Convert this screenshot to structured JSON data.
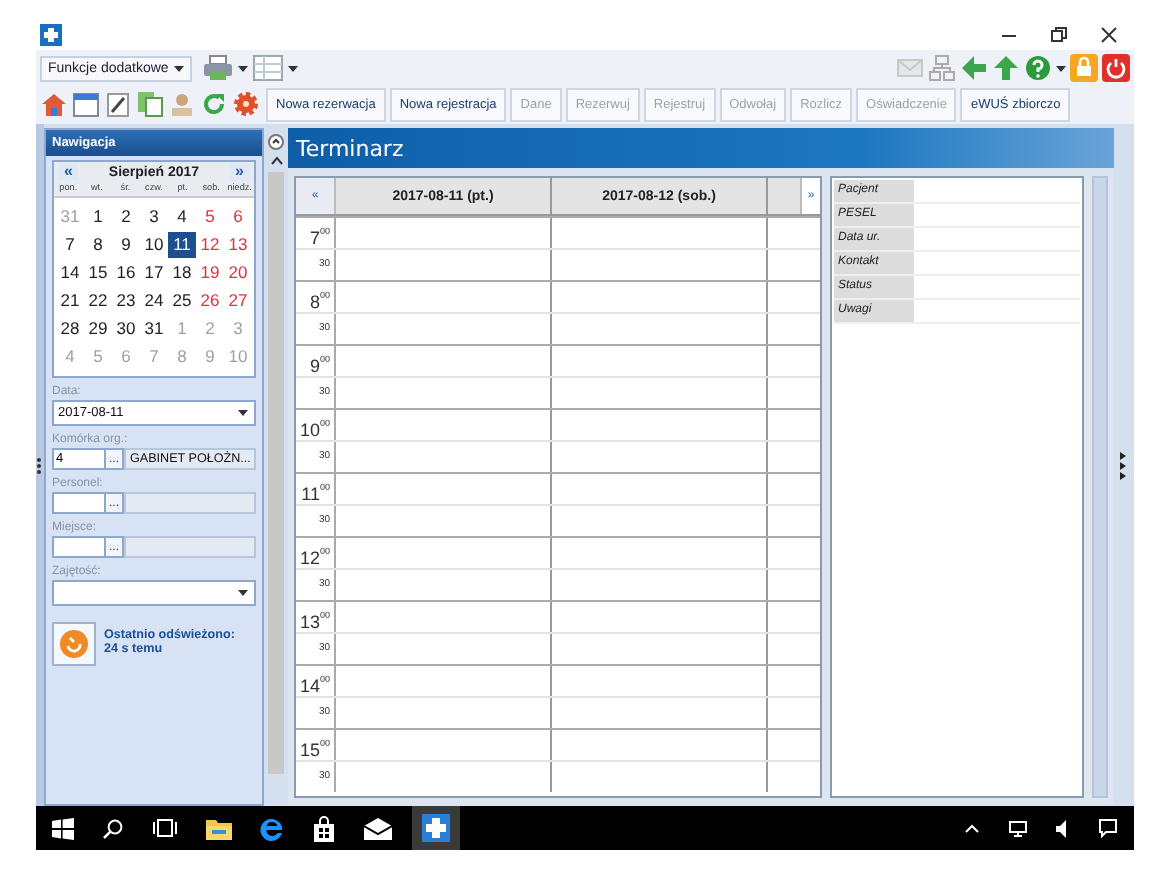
{
  "toolbar": {
    "menu": "Funkcje dodatkowe",
    "actions": [
      {
        "label": "Nowa rezerwacja",
        "disabled": false
      },
      {
        "label": "Nowa rejestracja",
        "disabled": false
      },
      {
        "label": "Dane",
        "disabled": true
      },
      {
        "label": "Rezerwuj",
        "disabled": true
      },
      {
        "label": "Rejestruj",
        "disabled": true
      },
      {
        "label": "Odwołaj",
        "disabled": true
      },
      {
        "label": "Rozlicz",
        "disabled": true
      },
      {
        "label": "Oświadczenie",
        "disabled": true
      },
      {
        "label": "eWUŚ zbiorczo",
        "disabled": false
      }
    ]
  },
  "navigation": {
    "title": "Nawigacja",
    "calendar": {
      "prev": "«",
      "month": "Sierpień 2017",
      "next": "»",
      "weekdays": [
        "pon.",
        "wt.",
        "śr.",
        "czw.",
        "pt.",
        "sob.",
        "niedz."
      ],
      "weeks": [
        [
          {
            "text": "31",
            "other_month": true,
            "selected": false
          },
          {
            "text": "1",
            "other_month": false,
            "selected": false
          },
          {
            "text": "2",
            "other_month": false,
            "selected": false
          },
          {
            "text": "3",
            "other_month": false,
            "selected": false
          },
          {
            "text": "4",
            "other_month": false,
            "selected": false
          },
          {
            "text": "5",
            "other_month": false,
            "selected": false
          },
          {
            "text": "6",
            "other_month": false,
            "selected": false
          }
        ],
        [
          {
            "text": "7",
            "other_month": false,
            "selected": false
          },
          {
            "text": "8",
            "other_month": false,
            "selected": false
          },
          {
            "text": "9",
            "other_month": false,
            "selected": false
          },
          {
            "text": "10",
            "other_month": false,
            "selected": false
          },
          {
            "text": "11",
            "other_month": false,
            "selected": true
          },
          {
            "text": "12",
            "other_month": false,
            "selected": false
          },
          {
            "text": "13",
            "other_month": false,
            "selected": false
          }
        ],
        [
          {
            "text": "14",
            "other_month": false,
            "selected": false
          },
          {
            "text": "15",
            "other_month": false,
            "selected": false
          },
          {
            "text": "16",
            "other_month": false,
            "selected": false
          },
          {
            "text": "17",
            "other_month": false,
            "selected": false
          },
          {
            "text": "18",
            "other_month": false,
            "selected": false
          },
          {
            "text": "19",
            "other_month": false,
            "selected": false
          },
          {
            "text": "20",
            "other_month": false,
            "selected": false
          }
        ],
        [
          {
            "text": "21",
            "other_month": false,
            "selected": false
          },
          {
            "text": "22",
            "other_month": false,
            "selected": false
          },
          {
            "text": "23",
            "other_month": false,
            "selected": false
          },
          {
            "text": "24",
            "other_month": false,
            "selected": false
          },
          {
            "text": "25",
            "other_month": false,
            "selected": false
          },
          {
            "text": "26",
            "other_month": false,
            "selected": false
          },
          {
            "text": "27",
            "other_month": false,
            "selected": false
          }
        ],
        [
          {
            "text": "28",
            "other_month": false,
            "selected": false
          },
          {
            "text": "29",
            "other_month": false,
            "selected": false
          },
          {
            "text": "30",
            "other_month": false,
            "selected": false
          },
          {
            "text": "31",
            "other_month": false,
            "selected": false
          },
          {
            "text": "1",
            "other_month": true,
            "selected": false
          },
          {
            "text": "2",
            "other_month": true,
            "selected": false
          },
          {
            "text": "3",
            "other_month": true,
            "selected": false
          }
        ],
        [
          {
            "text": "4",
            "other_month": true,
            "selected": false
          },
          {
            "text": "5",
            "other_month": true,
            "selected": false
          },
          {
            "text": "6",
            "other_month": true,
            "selected": false
          },
          {
            "text": "7",
            "other_month": true,
            "selected": false
          },
          {
            "text": "8",
            "other_month": true,
            "selected": false
          },
          {
            "text": "9",
            "other_month": true,
            "selected": false
          },
          {
            "text": "10",
            "other_month": true,
            "selected": false
          }
        ]
      ]
    },
    "fields": [
      {
        "label": "Data:",
        "kind": "dropdown",
        "value": "2017-08-11"
      },
      {
        "label": "Komórka org.:",
        "kind": "lookup",
        "value": "4",
        "button": "...",
        "name": "GABINET POŁOŻN..."
      },
      {
        "label": "Personel:",
        "kind": "lookup",
        "button": "..."
      },
      {
        "label": "Miejsce:",
        "kind": "lookup",
        "button": "..."
      },
      {
        "label": "Zajętość:",
        "kind": "dropdown"
      }
    ],
    "refresh": {
      "lines": [
        "Ostatnio odświeżono:",
        "24 s temu"
      ]
    }
  },
  "schedule": {
    "title": "Terminarz",
    "prev": "«",
    "next": "»",
    "days": [
      "2017-08-11 (pt.)",
      "2017-08-12 (sob.)"
    ],
    "slots": [
      {
        "kind": "hour",
        "label": "7$^{00}$"
      },
      {
        "kind": "half",
        "label": "30"
      },
      {
        "kind": "hour",
        "label": "8$^{00}$"
      },
      {
        "kind": "half",
        "label": "30"
      },
      {
        "kind": "hour",
        "label": "9$^{00}$"
      },
      {
        "kind": "half",
        "label": "30"
      },
      {
        "kind": "hour",
        "label": "10$^{00}$"
      },
      {
        "kind": "half",
        "label": "30"
      },
      {
        "kind": "hour",
        "label": "11$^{00}$"
      },
      {
        "kind": "half",
        "label": "30"
      },
      {
        "kind": "hour",
        "label": "12$^{00}$"
      },
      {
        "kind": "half",
        "label": "30"
      },
      {
        "kind": "hour",
        "label": "13$^{00}$"
      },
      {
        "kind": "half",
        "label": "30"
      },
      {
        "kind": "hour",
        "label": "14$^{00}$"
      },
      {
        "kind": "half",
        "label": "30"
      },
      {
        "kind": "hour",
        "label": "15$^{00}$"
      },
      {
        "kind": "half",
        "label": "30"
      }
    ]
  },
  "details": {
    "labels": [
      "Pacjent",
      "PESEL",
      "Data ur.",
      "Kontakt",
      "Status",
      "Uwagi"
    ]
  }
}
